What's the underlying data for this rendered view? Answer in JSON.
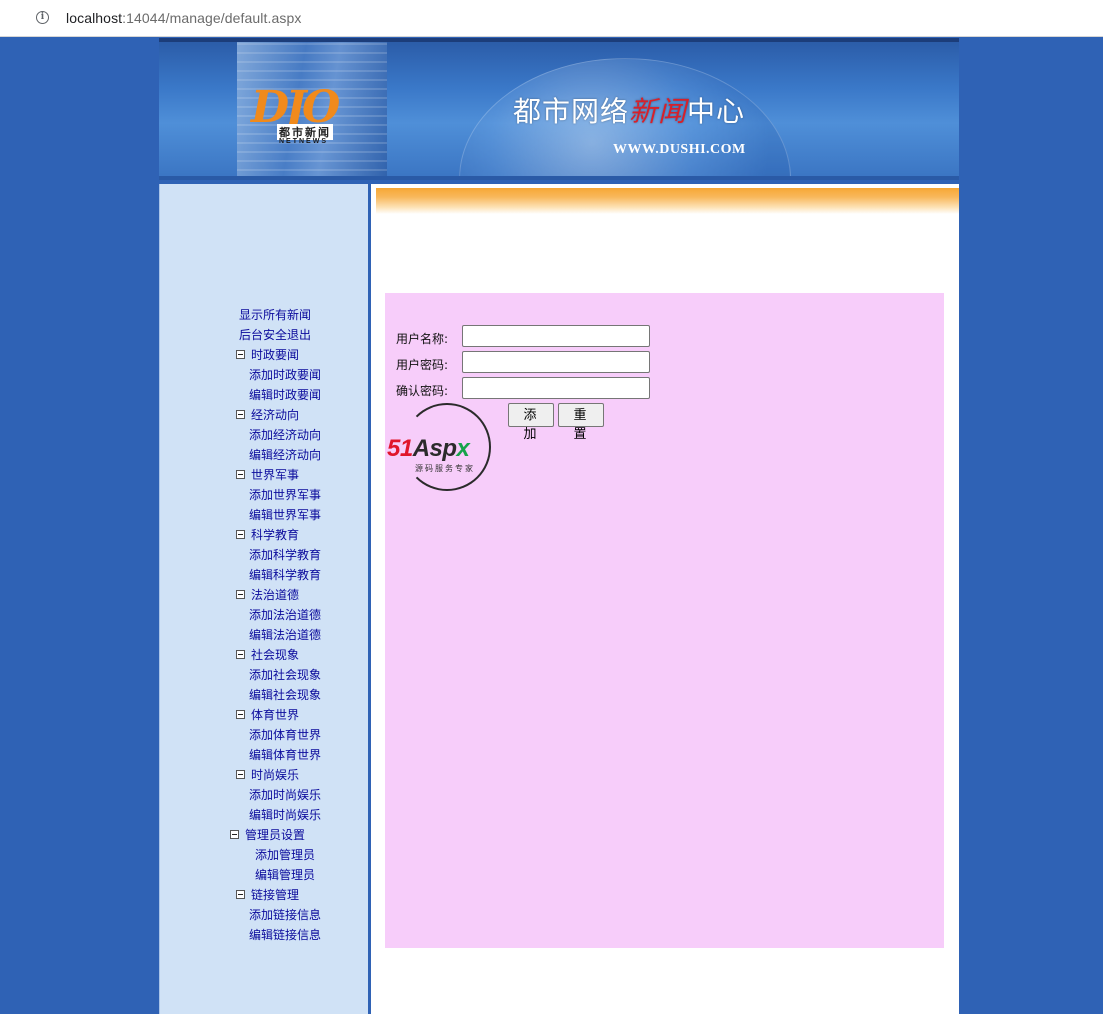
{
  "browser": {
    "url_host": "localhost",
    "url_rest": ":14044/manage/default.aspx"
  },
  "banner": {
    "logo_letters": "DJO",
    "logo_cn": "都市新闻",
    "logo_en": "NETNEWS",
    "title_pre": "都市网络",
    "title_red": "新闻",
    "title_post": "中心",
    "url": "WWW.DUSHI.COM"
  },
  "nav": {
    "show_all": "显示所有新闻",
    "logout": "后台安全退出",
    "groups": [
      {
        "label": "时政要闻",
        "add": "添加时政要闻",
        "edit": "编辑时政要闻"
      },
      {
        "label": "经济动向",
        "add": "添加经济动向",
        "edit": "编辑经济动向"
      },
      {
        "label": "世界军事",
        "add": "添加世界军事",
        "edit": "编辑世界军事"
      },
      {
        "label": "科学教育",
        "add": "添加科学教育",
        "edit": "编辑科学教育"
      },
      {
        "label": "法治道德",
        "add": "添加法治道德",
        "edit": "编辑法治道德"
      },
      {
        "label": "社会现象",
        "add": "添加社会现象",
        "edit": "编辑社会现象"
      },
      {
        "label": "体育世界",
        "add": "添加体育世界",
        "edit": "编辑体育世界"
      },
      {
        "label": "时尚娱乐",
        "add": "添加时尚娱乐",
        "edit": "编辑时尚娱乐"
      }
    ],
    "admin": {
      "label": "管理员设置",
      "add": "添加管理员",
      "edit": "编辑管理员"
    },
    "links": {
      "label": "链接管理",
      "add": "添加链接信息",
      "edit": "编辑链接信息"
    }
  },
  "form": {
    "username_label": "用户名称:",
    "password_label": "用户密码:",
    "confirm_label": "确认密码:",
    "username_value": "",
    "password_value": "",
    "confirm_value": "",
    "add_button": "添 加",
    "reset_button": "重 置"
  },
  "watermark": {
    "r": "51",
    "k": "Asp",
    "g": "x",
    "slogan": "源码服务专家"
  },
  "colors": {
    "page_bg": "#2f62b5",
    "nav_bg": "#d0e2f6",
    "panel_bg": "#f7cdfa",
    "link": "#0a0a9c",
    "accent_orange": "#f7a735"
  }
}
